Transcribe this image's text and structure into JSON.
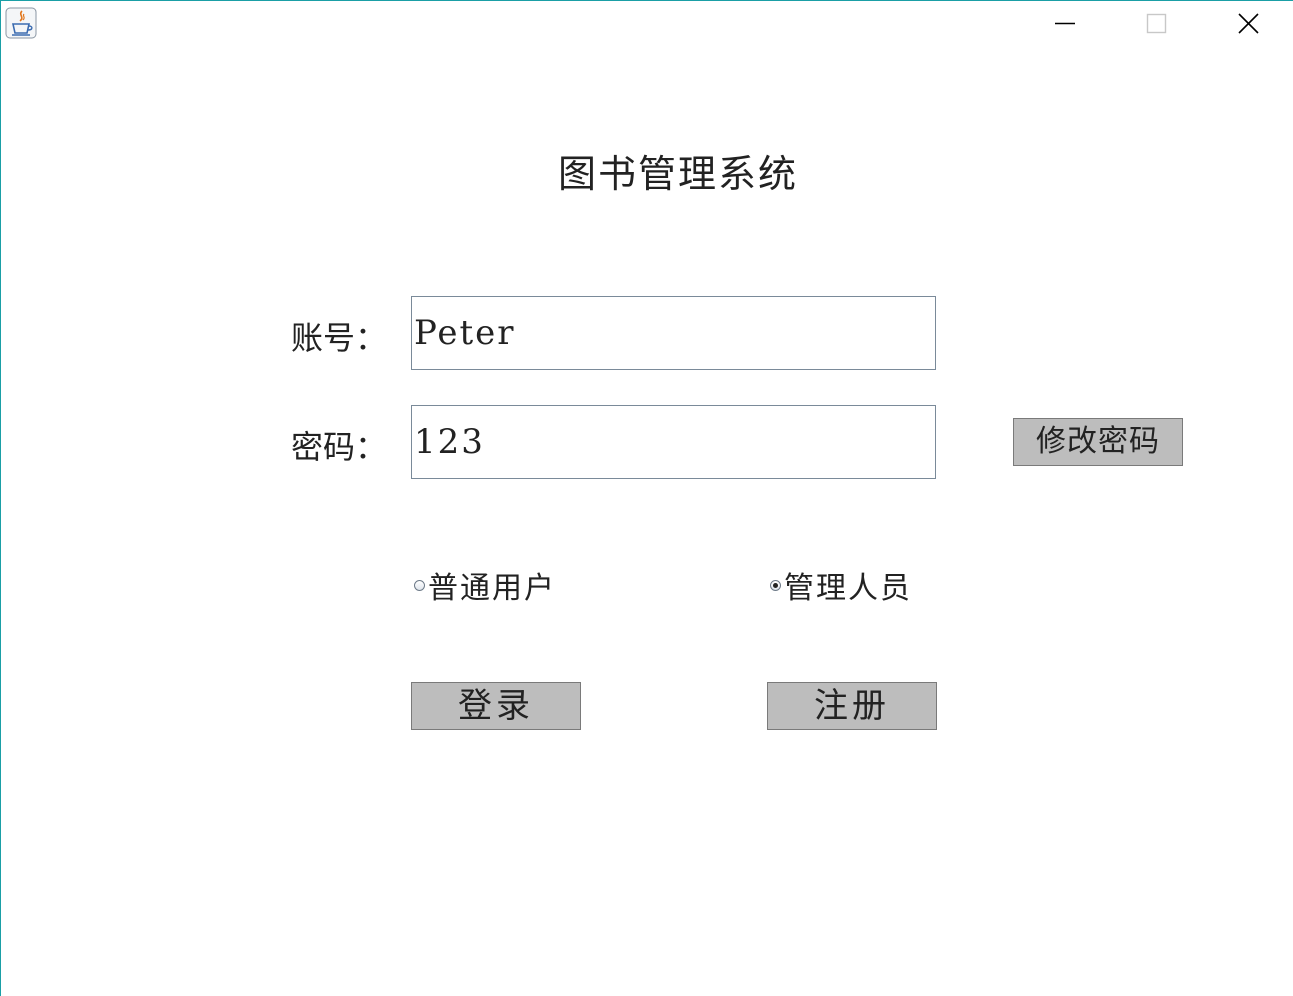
{
  "window": {
    "border_color": "#1a9fa6",
    "icon": "java-cup-icon",
    "controls": {
      "minimize_icon": "minimize-icon",
      "maximize_icon": "maximize-icon",
      "close_icon": "close-icon"
    }
  },
  "form": {
    "title": "图书管理系统",
    "account_label": "账号：",
    "account_value": "Peter",
    "password_label": "密码：",
    "password_value": "123",
    "change_password_label": "修改密码",
    "role_options": [
      {
        "label": "普通用户",
        "selected": false
      },
      {
        "label": "管理人员",
        "selected": true
      }
    ],
    "login_label": "登录",
    "register_label": "注册"
  },
  "colors": {
    "button_bg": "#bdbdbd",
    "field_border": "#7a8a99"
  }
}
